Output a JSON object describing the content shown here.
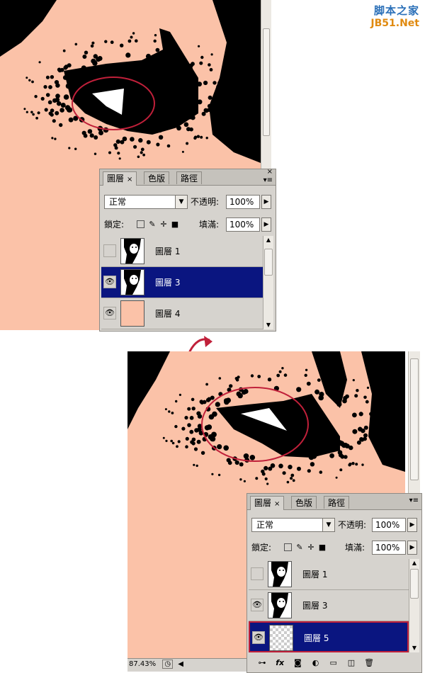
{
  "watermark": {
    "line1": "脚本之家",
    "line2": "JB51.Net"
  },
  "colors": {
    "canvas": "#fbc2a8",
    "selected_row": "#0a1580",
    "annotation": "#c0203a"
  },
  "top_panel": {
    "tabs": [
      "圖層",
      "色版",
      "路徑"
    ],
    "blend_mode": "正常",
    "opacity_label": "不透明:",
    "opacity_value": "100%",
    "lock_label": "鎖定:",
    "fill_label": "填滿:",
    "fill_value": "100%",
    "layers": [
      {
        "name": "圖層 1",
        "visible": false,
        "selected": false,
        "thumb": "portrait"
      },
      {
        "name": "圖層 3",
        "visible": true,
        "selected": true,
        "thumb": "portrait"
      },
      {
        "name": "圖層 4",
        "visible": true,
        "selected": false,
        "thumb": "fill"
      }
    ]
  },
  "bottom_panel": {
    "tabs": [
      "圖層",
      "色版",
      "路徑"
    ],
    "blend_mode": "正常",
    "opacity_label": "不透明:",
    "opacity_value": "100%",
    "lock_label": "鎖定:",
    "fill_label": "填滿:",
    "fill_value": "100%",
    "layers": [
      {
        "name": "圖層 1",
        "visible": false,
        "selected": false,
        "thumb": "portrait"
      },
      {
        "name": "圖層 3",
        "visible": true,
        "selected": false,
        "thumb": "portrait"
      },
      {
        "name": "圖層 5",
        "visible": true,
        "selected": true,
        "thumb": "transparent"
      }
    ],
    "footer_icons": [
      "link-icon",
      "fx-icon",
      "mask-icon",
      "adjustment-icon",
      "folder-icon",
      "new-layer-icon",
      "trash-icon"
    ]
  },
  "status": {
    "zoom": "87.43%"
  }
}
